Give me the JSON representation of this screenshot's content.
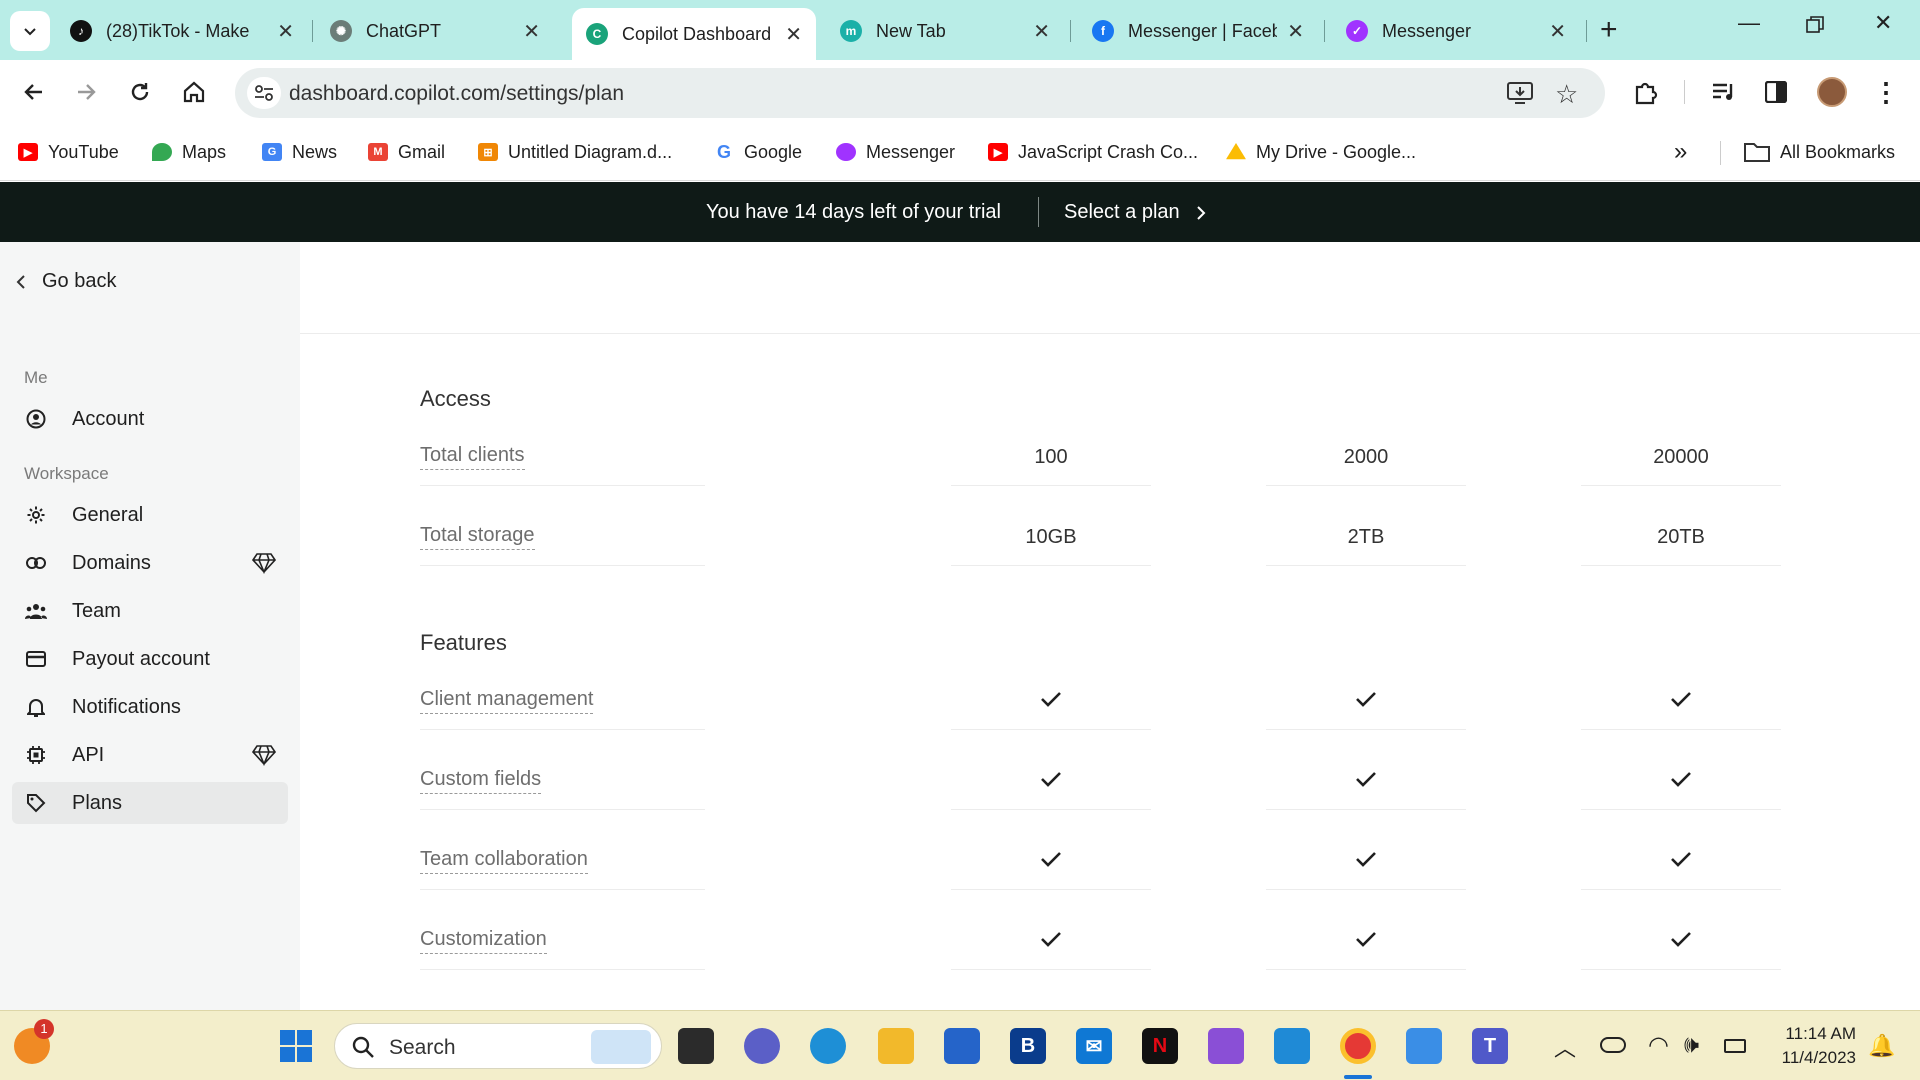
{
  "browser": {
    "tabs": [
      {
        "title": "(28)TikTok - Make",
        "favicon": "tiktok-icon",
        "color": "#111111"
      },
      {
        "title": "ChatGPT",
        "favicon": "chatgpt-icon",
        "color": "#6b7d78"
      },
      {
        "title": "Copilot Dashboard",
        "favicon": "copilot-icon",
        "color": "#1aa37a",
        "active": true
      },
      {
        "title": "New Tab",
        "favicon": "m-icon",
        "color": "#1bb0a8"
      },
      {
        "title": "Messenger | Faceb",
        "favicon": "facebook-icon",
        "color": "#1877f2"
      },
      {
        "title": "Messenger",
        "favicon": "messenger-icon",
        "color": "#a033ff"
      }
    ],
    "url": "dashboard.copilot.com/settings/plan",
    "bookmarks": [
      {
        "label": "YouTube",
        "icon": "youtube-icon",
        "color": "#ff0000"
      },
      {
        "label": "Maps",
        "icon": "maps-icon",
        "color": "#34a853"
      },
      {
        "label": "News",
        "icon": "news-icon",
        "color": "#4285f4"
      },
      {
        "label": "Gmail",
        "icon": "gmail-icon",
        "color": "#ea4335"
      },
      {
        "label": "Untitled Diagram.d...",
        "icon": "drawio-icon",
        "color": "#f08705"
      },
      {
        "label": "Google",
        "icon": "google-icon",
        "color": "#4285f4"
      },
      {
        "label": "Messenger",
        "icon": "messenger-icon",
        "color": "#a033ff"
      },
      {
        "label": "JavaScript Crash Co...",
        "icon": "youtube-icon",
        "color": "#ff0000"
      },
      {
        "label": "My Drive - Google...",
        "icon": "drive-icon",
        "color": "#fbbc04"
      }
    ],
    "all_bookmarks": "All Bookmarks"
  },
  "banner": {
    "message": "You have 14 days left of your trial",
    "cta": "Select a plan"
  },
  "sidebar": {
    "go_back": "Go back",
    "group_me": "Me",
    "group_workspace": "Workspace",
    "items": [
      {
        "label": "Account",
        "icon": "account-icon"
      },
      {
        "label": "General",
        "icon": "gear-icon"
      },
      {
        "label": "Domains",
        "icon": "link-icon",
        "premium": true
      },
      {
        "label": "Team",
        "icon": "team-icon"
      },
      {
        "label": "Payout account",
        "icon": "card-icon"
      },
      {
        "label": "Notifications",
        "icon": "bell-icon"
      },
      {
        "label": "API",
        "icon": "chip-icon",
        "premium": true
      },
      {
        "label": "Plans",
        "icon": "tag-icon",
        "active": true
      }
    ]
  },
  "plans_table": {
    "sections": [
      {
        "title": "Access",
        "rows": [
          {
            "label": "Total clients",
            "values": [
              "100",
              "2000",
              "20000"
            ]
          },
          {
            "label": "Total storage",
            "values": [
              "10GB",
              "2TB",
              "20TB"
            ]
          }
        ]
      },
      {
        "title": "Features",
        "rows": [
          {
            "label": "Client management",
            "values": [
              true,
              true,
              true
            ]
          },
          {
            "label": "Custom fields",
            "values": [
              true,
              true,
              true
            ]
          },
          {
            "label": "Team collaboration",
            "values": [
              true,
              true,
              true
            ]
          },
          {
            "label": "Customization",
            "values": [
              true,
              true,
              true
            ]
          }
        ]
      }
    ]
  },
  "taskbar": {
    "search_label": "Search",
    "time": "11:14 AM",
    "date": "11/4/2023",
    "weather_badge": "1"
  }
}
